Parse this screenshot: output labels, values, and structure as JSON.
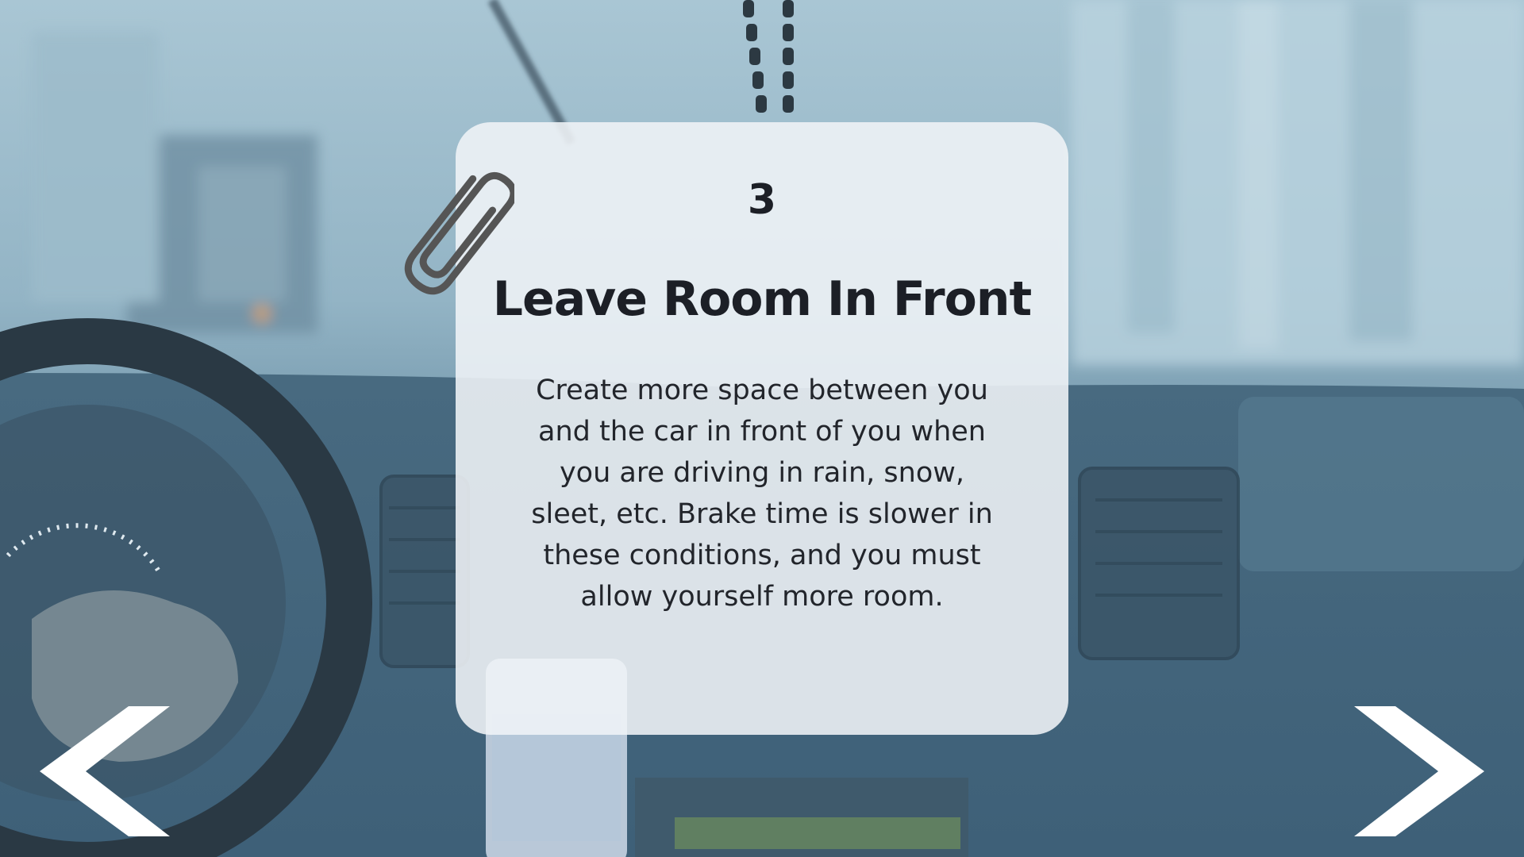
{
  "slide": {
    "step_number": "3",
    "title": "Leave Room In Front",
    "body": "Create more space between you and the car in front of you when you are driving in rain, snow, sleet, etc. Brake time is slower in these conditions, and you must allow yourself more room."
  },
  "navigation": {
    "prev_icon": "chevron-left-icon",
    "next_icon": "chevron-right-icon"
  },
  "colors": {
    "card_background": "#f0f4f7",
    "text": "#1c1f26",
    "arrow": "#ffffff",
    "paperclip": "#555555"
  }
}
